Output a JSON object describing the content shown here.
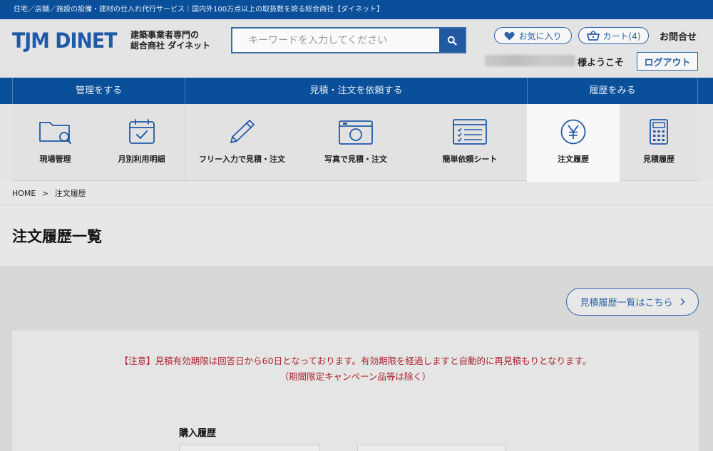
{
  "topbar": {
    "text": "住宅／店舗／施設の設備・建材の仕入れ代行サービス｜国内外100万点以上の取扱数を誇る総合商社【ダイネット】"
  },
  "header": {
    "logo": "TJM DINET",
    "tagline_line1": "建築事業者専門の",
    "tagline_line2": "総合商社 ダイネット",
    "search_placeholder": "キーワードを入力してください",
    "favorites_label": "お気に入り",
    "cart_label": "カート(4)",
    "contact_label": "お問合せ",
    "welcome_suffix": "様ようこそ",
    "logout_label": "ログアウト"
  },
  "nav": {
    "groups": [
      {
        "label": "管理をする"
      },
      {
        "label": "見積・注文を依頼する"
      },
      {
        "label": "履歴をみる"
      }
    ],
    "items": [
      {
        "label": "現場管理",
        "icon": "folder-search-icon"
      },
      {
        "label": "月別利用明細",
        "icon": "calendar-check-icon"
      },
      {
        "label": "フリー入力で見積・注文",
        "icon": "pencil-icon"
      },
      {
        "label": "写真で見積・注文",
        "icon": "camera-icon"
      },
      {
        "label": "簡単依頼シート",
        "icon": "checklist-icon"
      },
      {
        "label": "注文履歴",
        "icon": "yen-icon",
        "active": true
      },
      {
        "label": "見積履歴",
        "icon": "calculator-icon"
      }
    ]
  },
  "breadcrumb": {
    "home": "HOME",
    "separator": ">",
    "current": "注文履歴"
  },
  "page": {
    "title": "注文履歴一覧",
    "estimate_link": "見積履歴一覧はこちら",
    "notice_line1": "【注意】見積有効期限は回答日から60日となっております。有効期限を経過しますと自動的に再見積もりとなります。",
    "notice_line2": "（期間限定キャンペーン品等は除く）",
    "section_title": "購入履歴"
  },
  "colors": {
    "brand_blue": "#0a4f99",
    "accent_blue": "#2c62a8",
    "notice_red": "#a9242f"
  }
}
